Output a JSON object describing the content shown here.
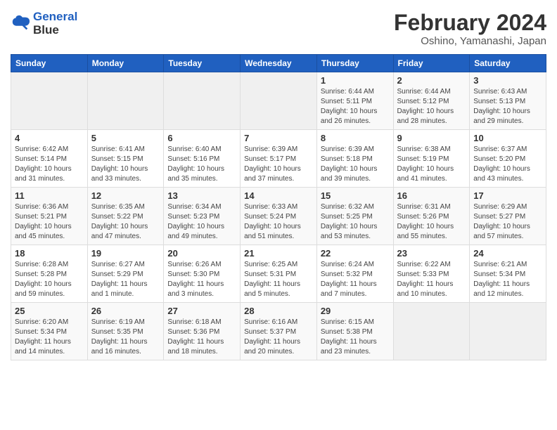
{
  "header": {
    "logo_line1": "General",
    "logo_line2": "Blue",
    "title": "February 2024",
    "subtitle": "Oshino, Yamanashi, Japan"
  },
  "days_of_week": [
    "Sunday",
    "Monday",
    "Tuesday",
    "Wednesday",
    "Thursday",
    "Friday",
    "Saturday"
  ],
  "weeks": [
    [
      {
        "day": "",
        "info": ""
      },
      {
        "day": "",
        "info": ""
      },
      {
        "day": "",
        "info": ""
      },
      {
        "day": "",
        "info": ""
      },
      {
        "day": "1",
        "info": "Sunrise: 6:44 AM\nSunset: 5:11 PM\nDaylight: 10 hours\nand 26 minutes."
      },
      {
        "day": "2",
        "info": "Sunrise: 6:44 AM\nSunset: 5:12 PM\nDaylight: 10 hours\nand 28 minutes."
      },
      {
        "day": "3",
        "info": "Sunrise: 6:43 AM\nSunset: 5:13 PM\nDaylight: 10 hours\nand 29 minutes."
      }
    ],
    [
      {
        "day": "4",
        "info": "Sunrise: 6:42 AM\nSunset: 5:14 PM\nDaylight: 10 hours\nand 31 minutes."
      },
      {
        "day": "5",
        "info": "Sunrise: 6:41 AM\nSunset: 5:15 PM\nDaylight: 10 hours\nand 33 minutes."
      },
      {
        "day": "6",
        "info": "Sunrise: 6:40 AM\nSunset: 5:16 PM\nDaylight: 10 hours\nand 35 minutes."
      },
      {
        "day": "7",
        "info": "Sunrise: 6:39 AM\nSunset: 5:17 PM\nDaylight: 10 hours\nand 37 minutes."
      },
      {
        "day": "8",
        "info": "Sunrise: 6:39 AM\nSunset: 5:18 PM\nDaylight: 10 hours\nand 39 minutes."
      },
      {
        "day": "9",
        "info": "Sunrise: 6:38 AM\nSunset: 5:19 PM\nDaylight: 10 hours\nand 41 minutes."
      },
      {
        "day": "10",
        "info": "Sunrise: 6:37 AM\nSunset: 5:20 PM\nDaylight: 10 hours\nand 43 minutes."
      }
    ],
    [
      {
        "day": "11",
        "info": "Sunrise: 6:36 AM\nSunset: 5:21 PM\nDaylight: 10 hours\nand 45 minutes."
      },
      {
        "day": "12",
        "info": "Sunrise: 6:35 AM\nSunset: 5:22 PM\nDaylight: 10 hours\nand 47 minutes."
      },
      {
        "day": "13",
        "info": "Sunrise: 6:34 AM\nSunset: 5:23 PM\nDaylight: 10 hours\nand 49 minutes."
      },
      {
        "day": "14",
        "info": "Sunrise: 6:33 AM\nSunset: 5:24 PM\nDaylight: 10 hours\nand 51 minutes."
      },
      {
        "day": "15",
        "info": "Sunrise: 6:32 AM\nSunset: 5:25 PM\nDaylight: 10 hours\nand 53 minutes."
      },
      {
        "day": "16",
        "info": "Sunrise: 6:31 AM\nSunset: 5:26 PM\nDaylight: 10 hours\nand 55 minutes."
      },
      {
        "day": "17",
        "info": "Sunrise: 6:29 AM\nSunset: 5:27 PM\nDaylight: 10 hours\nand 57 minutes."
      }
    ],
    [
      {
        "day": "18",
        "info": "Sunrise: 6:28 AM\nSunset: 5:28 PM\nDaylight: 10 hours\nand 59 minutes."
      },
      {
        "day": "19",
        "info": "Sunrise: 6:27 AM\nSunset: 5:29 PM\nDaylight: 11 hours\nand 1 minute."
      },
      {
        "day": "20",
        "info": "Sunrise: 6:26 AM\nSunset: 5:30 PM\nDaylight: 11 hours\nand 3 minutes."
      },
      {
        "day": "21",
        "info": "Sunrise: 6:25 AM\nSunset: 5:31 PM\nDaylight: 11 hours\nand 5 minutes."
      },
      {
        "day": "22",
        "info": "Sunrise: 6:24 AM\nSunset: 5:32 PM\nDaylight: 11 hours\nand 7 minutes."
      },
      {
        "day": "23",
        "info": "Sunrise: 6:22 AM\nSunset: 5:33 PM\nDaylight: 11 hours\nand 10 minutes."
      },
      {
        "day": "24",
        "info": "Sunrise: 6:21 AM\nSunset: 5:34 PM\nDaylight: 11 hours\nand 12 minutes."
      }
    ],
    [
      {
        "day": "25",
        "info": "Sunrise: 6:20 AM\nSunset: 5:34 PM\nDaylight: 11 hours\nand 14 minutes."
      },
      {
        "day": "26",
        "info": "Sunrise: 6:19 AM\nSunset: 5:35 PM\nDaylight: 11 hours\nand 16 minutes."
      },
      {
        "day": "27",
        "info": "Sunrise: 6:18 AM\nSunset: 5:36 PM\nDaylight: 11 hours\nand 18 minutes."
      },
      {
        "day": "28",
        "info": "Sunrise: 6:16 AM\nSunset: 5:37 PM\nDaylight: 11 hours\nand 20 minutes."
      },
      {
        "day": "29",
        "info": "Sunrise: 6:15 AM\nSunset: 5:38 PM\nDaylight: 11 hours\nand 23 minutes."
      },
      {
        "day": "",
        "info": ""
      },
      {
        "day": "",
        "info": ""
      }
    ]
  ]
}
